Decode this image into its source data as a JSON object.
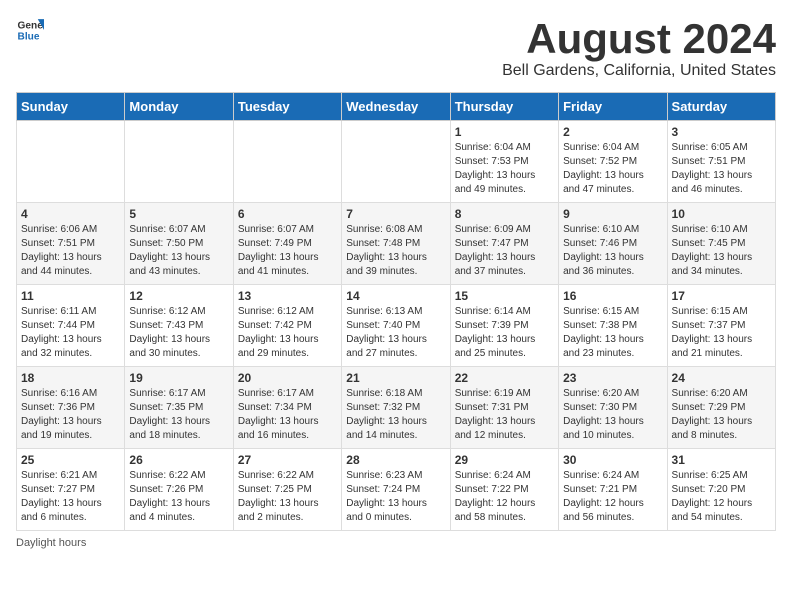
{
  "header": {
    "logo_general": "General",
    "logo_blue": "Blue",
    "main_title": "August 2024",
    "subtitle": "Bell Gardens, California, United States"
  },
  "calendar": {
    "days_of_week": [
      "Sunday",
      "Monday",
      "Tuesday",
      "Wednesday",
      "Thursday",
      "Friday",
      "Saturday"
    ],
    "weeks": [
      [
        {
          "day": "",
          "info": ""
        },
        {
          "day": "",
          "info": ""
        },
        {
          "day": "",
          "info": ""
        },
        {
          "day": "",
          "info": ""
        },
        {
          "day": "1",
          "info": "Sunrise: 6:04 AM\nSunset: 7:53 PM\nDaylight: 13 hours and 49 minutes."
        },
        {
          "day": "2",
          "info": "Sunrise: 6:04 AM\nSunset: 7:52 PM\nDaylight: 13 hours and 47 minutes."
        },
        {
          "day": "3",
          "info": "Sunrise: 6:05 AM\nSunset: 7:51 PM\nDaylight: 13 hours and 46 minutes."
        }
      ],
      [
        {
          "day": "4",
          "info": "Sunrise: 6:06 AM\nSunset: 7:51 PM\nDaylight: 13 hours and 44 minutes."
        },
        {
          "day": "5",
          "info": "Sunrise: 6:07 AM\nSunset: 7:50 PM\nDaylight: 13 hours and 43 minutes."
        },
        {
          "day": "6",
          "info": "Sunrise: 6:07 AM\nSunset: 7:49 PM\nDaylight: 13 hours and 41 minutes."
        },
        {
          "day": "7",
          "info": "Sunrise: 6:08 AM\nSunset: 7:48 PM\nDaylight: 13 hours and 39 minutes."
        },
        {
          "day": "8",
          "info": "Sunrise: 6:09 AM\nSunset: 7:47 PM\nDaylight: 13 hours and 37 minutes."
        },
        {
          "day": "9",
          "info": "Sunrise: 6:10 AM\nSunset: 7:46 PM\nDaylight: 13 hours and 36 minutes."
        },
        {
          "day": "10",
          "info": "Sunrise: 6:10 AM\nSunset: 7:45 PM\nDaylight: 13 hours and 34 minutes."
        }
      ],
      [
        {
          "day": "11",
          "info": "Sunrise: 6:11 AM\nSunset: 7:44 PM\nDaylight: 13 hours and 32 minutes."
        },
        {
          "day": "12",
          "info": "Sunrise: 6:12 AM\nSunset: 7:43 PM\nDaylight: 13 hours and 30 minutes."
        },
        {
          "day": "13",
          "info": "Sunrise: 6:12 AM\nSunset: 7:42 PM\nDaylight: 13 hours and 29 minutes."
        },
        {
          "day": "14",
          "info": "Sunrise: 6:13 AM\nSunset: 7:40 PM\nDaylight: 13 hours and 27 minutes."
        },
        {
          "day": "15",
          "info": "Sunrise: 6:14 AM\nSunset: 7:39 PM\nDaylight: 13 hours and 25 minutes."
        },
        {
          "day": "16",
          "info": "Sunrise: 6:15 AM\nSunset: 7:38 PM\nDaylight: 13 hours and 23 minutes."
        },
        {
          "day": "17",
          "info": "Sunrise: 6:15 AM\nSunset: 7:37 PM\nDaylight: 13 hours and 21 minutes."
        }
      ],
      [
        {
          "day": "18",
          "info": "Sunrise: 6:16 AM\nSunset: 7:36 PM\nDaylight: 13 hours and 19 minutes."
        },
        {
          "day": "19",
          "info": "Sunrise: 6:17 AM\nSunset: 7:35 PM\nDaylight: 13 hours and 18 minutes."
        },
        {
          "day": "20",
          "info": "Sunrise: 6:17 AM\nSunset: 7:34 PM\nDaylight: 13 hours and 16 minutes."
        },
        {
          "day": "21",
          "info": "Sunrise: 6:18 AM\nSunset: 7:32 PM\nDaylight: 13 hours and 14 minutes."
        },
        {
          "day": "22",
          "info": "Sunrise: 6:19 AM\nSunset: 7:31 PM\nDaylight: 13 hours and 12 minutes."
        },
        {
          "day": "23",
          "info": "Sunrise: 6:20 AM\nSunset: 7:30 PM\nDaylight: 13 hours and 10 minutes."
        },
        {
          "day": "24",
          "info": "Sunrise: 6:20 AM\nSunset: 7:29 PM\nDaylight: 13 hours and 8 minutes."
        }
      ],
      [
        {
          "day": "25",
          "info": "Sunrise: 6:21 AM\nSunset: 7:27 PM\nDaylight: 13 hours and 6 minutes."
        },
        {
          "day": "26",
          "info": "Sunrise: 6:22 AM\nSunset: 7:26 PM\nDaylight: 13 hours and 4 minutes."
        },
        {
          "day": "27",
          "info": "Sunrise: 6:22 AM\nSunset: 7:25 PM\nDaylight: 13 hours and 2 minutes."
        },
        {
          "day": "28",
          "info": "Sunrise: 6:23 AM\nSunset: 7:24 PM\nDaylight: 13 hours and 0 minutes."
        },
        {
          "day": "29",
          "info": "Sunrise: 6:24 AM\nSunset: 7:22 PM\nDaylight: 12 hours and 58 minutes."
        },
        {
          "day": "30",
          "info": "Sunrise: 6:24 AM\nSunset: 7:21 PM\nDaylight: 12 hours and 56 minutes."
        },
        {
          "day": "31",
          "info": "Sunrise: 6:25 AM\nSunset: 7:20 PM\nDaylight: 12 hours and 54 minutes."
        }
      ]
    ]
  },
  "footer": {
    "daylight_label": "Daylight hours"
  }
}
